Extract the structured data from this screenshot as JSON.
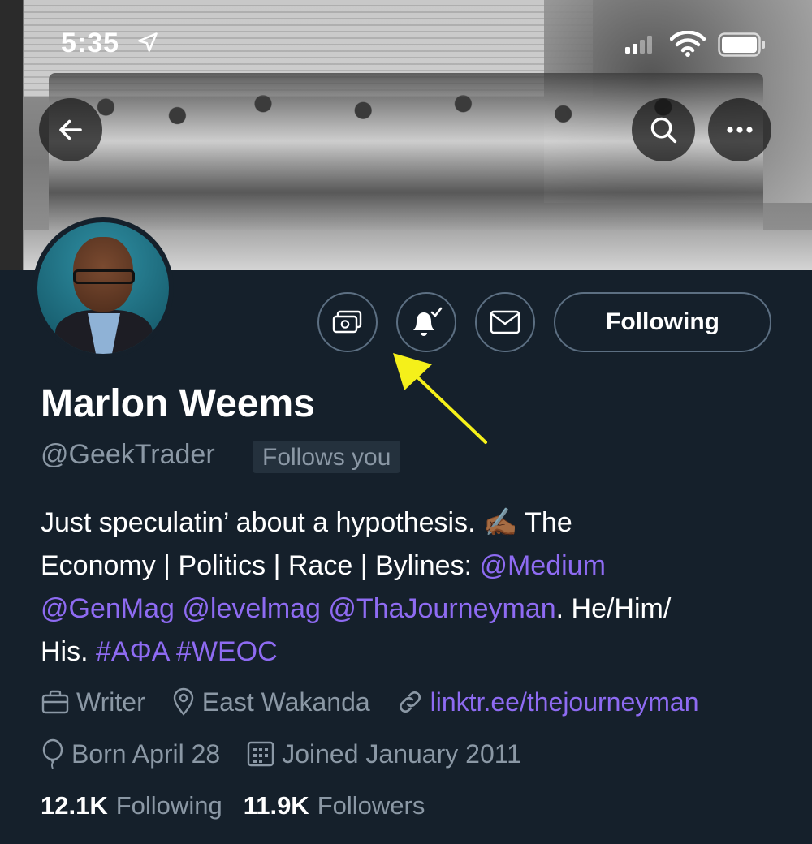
{
  "status_bar": {
    "time": "5:35"
  },
  "header": {
    "back_icon": "back-arrow-icon",
    "search_icon": "search-icon",
    "more_icon": "more-icon"
  },
  "actions": {
    "tip_icon": "money-icon",
    "notify_icon": "bell-check-icon",
    "message_icon": "envelope-icon",
    "follow_label": "Following"
  },
  "profile": {
    "name": "Marlon Weems",
    "handle": "@GeekTrader",
    "follows_you": "Follows you"
  },
  "bio": {
    "line1_text": "Just speculatin’ about a hypothesis. ",
    "emoji": "✍🏾",
    "line1_text2": " The",
    "line2_text": "Economy | Politics | Race | Bylines: ",
    "mention_medium": "@Medium",
    "mention_genmag": "@GenMag",
    "mention_levelmag": "@levelmag",
    "mention_journeyman": "@ThaJourneyman",
    "line3_tail": ". He/Him/",
    "line4_text": "His. ",
    "hashtag_apa": "#AΦA",
    "hashtag_weoc": "#WEOC"
  },
  "meta": {
    "profession": "Writer",
    "location": "East Wakanda",
    "website": "linktr.ee/thejourneyman",
    "birthday": "Born April 28",
    "joined": "Joined January 2011"
  },
  "stats": {
    "following_count": "12.1K",
    "following_label": "Following",
    "followers_count": "11.9K",
    "followers_label": "Followers"
  },
  "colors": {
    "background": "#15202b",
    "link": "#8e6bf2",
    "muted": "#8b98a5",
    "annotation_arrow": "#f5f01a"
  }
}
